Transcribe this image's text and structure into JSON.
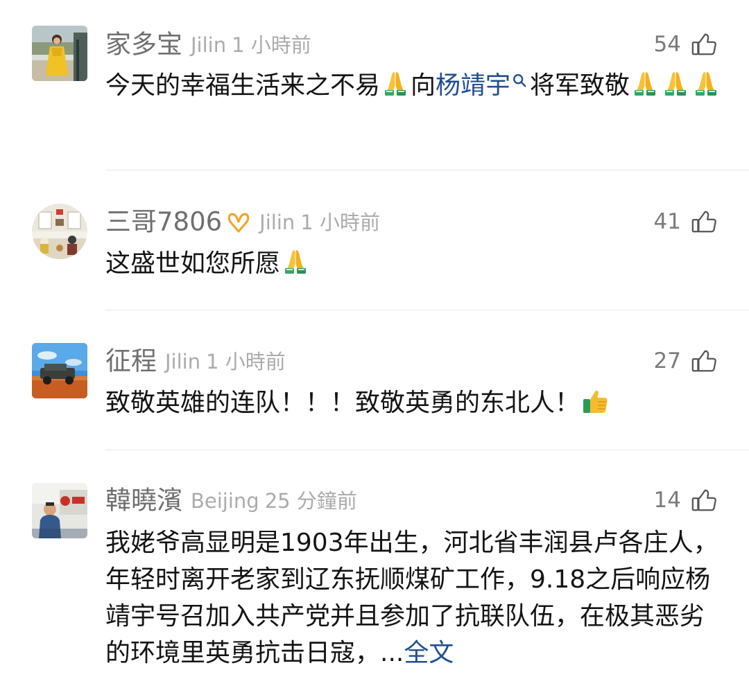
{
  "comments": [
    {
      "username": "家多宝",
      "location": "Jilin",
      "time": "1 小時前",
      "likes": "54",
      "text_parts": [
        "今天的幸福生活来之不易",
        "向",
        "杨靖宇",
        "将军致敬"
      ]
    },
    {
      "username": "三哥7806",
      "location": "Jilin",
      "time": "1 小時前",
      "likes": "41",
      "text_parts": [
        "这盛世如您所愿"
      ]
    },
    {
      "username": "征程",
      "location": "Jilin",
      "time": "1 小時前",
      "likes": "27",
      "text_parts": [
        "致敬英雄的连队！！！致敬英勇的东北人！"
      ]
    },
    {
      "username": "韓曉濱",
      "location": "Beijing",
      "time": "25 分鐘前",
      "likes": "14",
      "text_parts": [
        "我姥爷高显明是1903年出生，河北省丰润县卢各庄人，年轻时离开老家到辽东抚顺煤矿工作，9.18之后响应杨靖宇号召加入共产党并且参加了抗联队伍，在极其恶劣的环境里英勇抗击日寇，...",
        "全文"
      ]
    }
  ],
  "icons": {
    "like": "thumbs-up-icon",
    "search": "search-icon",
    "prayer": "folded-hands-emoji",
    "thumbs_up_emoji": "thumbs-up-emoji",
    "badge": "infinity-badge-icon"
  },
  "colors": {
    "username": "#6f6f6f",
    "meta": "#ababab",
    "link": "#1f4f8f",
    "badge": "#f5a623"
  }
}
